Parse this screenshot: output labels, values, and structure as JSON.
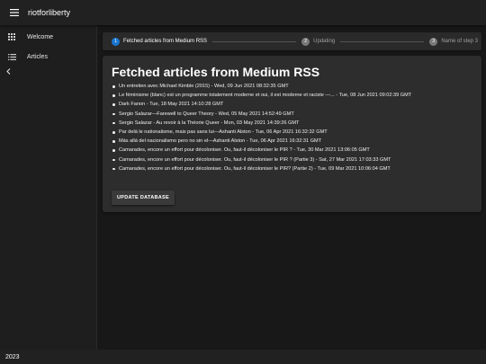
{
  "appbar": {
    "title": "riotforliberty",
    "menu_icon": "hamburger-menu-icon"
  },
  "drawer": {
    "items": [
      {
        "label": "Welcome",
        "icon": "grid-apps-icon"
      },
      {
        "label": "Articles",
        "icon": "list-icon"
      }
    ],
    "collapse_icon": "chevron-left-icon"
  },
  "stepper": {
    "steps": [
      {
        "num": "1",
        "label": "Fetched articles from Medium RSS",
        "state": "active"
      },
      {
        "num": "2",
        "label": "Updating",
        "state": "inactive"
      },
      {
        "num": "3",
        "label": "Name of step 3",
        "state": "inactive"
      }
    ]
  },
  "card": {
    "title": "Fetched articles from Medium RSS",
    "articles": [
      "Un entretien avec Michael Kimble (2015) - Wed, 09 Jun 2021 08:32:35 GMT",
      "Le féminisme (blanc) est un programme totalement moderne et oui, il est moderne et raciste —... - Tue, 08 Jun 2021 09:02:39 GMT",
      "Dark Fanon - Tue, 18 May 2021 14:10:28 GMT",
      "Sergio Salazar—Farewell to Queer Theory - Wed, 05 May 2021 14:52:49 GMT",
      "Sergio Salazar - Au revoir à la Théorie Queer - Mon, 03 May 2021 14:39:26 GMT",
      "Par delà le nationalisme, mais pas sans lui—Ashanti Alston - Tue, 06 Apr 2021 16:32:32 GMT",
      "Más allá del nacionalismo pero no sin el—Ashanti Alston - Tue, 06 Apr 2021 16:32:31 GMT",
      "Camarades, encore un effort pour décoloniser. Ou, faut-il décoloniser le PIR ? - Tue, 30 Mar 2021 13:06:05 GMT",
      "Camarades, encore un effort pour décoloniser. Ou, faut-il décoloniser le PIR ? (Partie 3) - Sat, 27 Mar 2021 17:03:33 GMT",
      "Camarades, encore un effort pour décoloniser. Ou, faut-il décoloniser le PIR? (Partie 2) - Tue, 09 Mar 2021 10:06:04 GMT"
    ],
    "button_label": "UPDATE DATABASE"
  },
  "footer": {
    "text": "2023"
  },
  "colors": {
    "accent": "#1976d2",
    "appbar": "#212121",
    "card": "#2d2d2d"
  }
}
